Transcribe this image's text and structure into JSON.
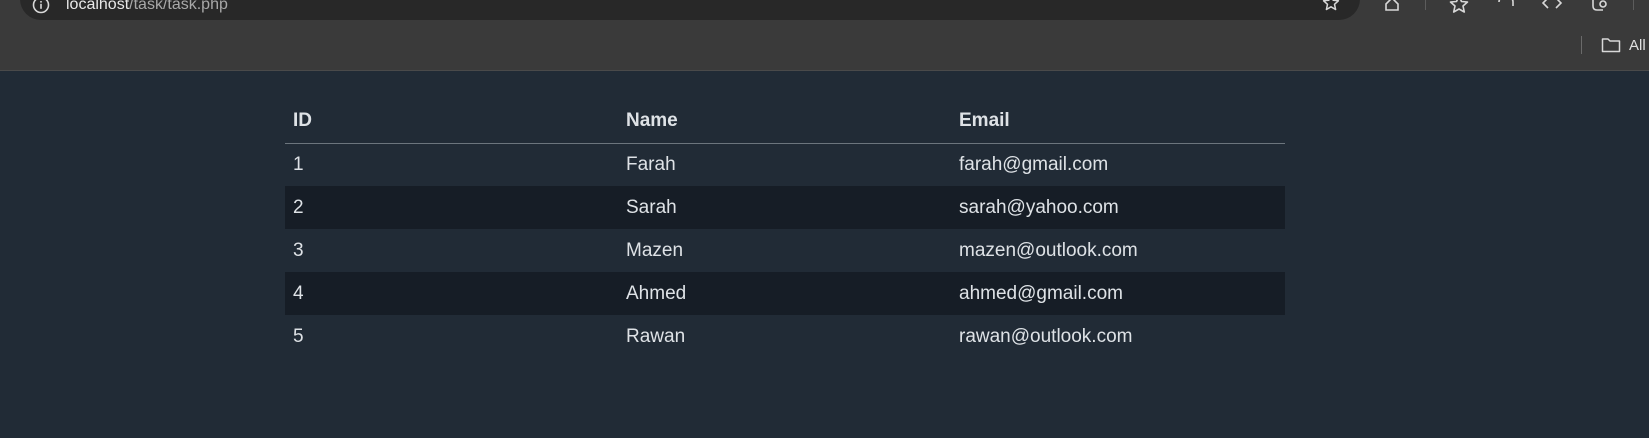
{
  "browser": {
    "url_host": "localhost",
    "url_path": "/task/task.php",
    "bookmarks_all_label": "All"
  },
  "table": {
    "headers": [
      "ID",
      "Name",
      "Email"
    ],
    "rows": [
      [
        "1",
        "Farah",
        "farah@gmail.com"
      ],
      [
        "2",
        "Sarah",
        "sarah@yahoo.com"
      ],
      [
        "3",
        "Mazen",
        "mazen@outlook.com"
      ],
      [
        "4",
        "Ahmed",
        "ahmed@gmail.com"
      ],
      [
        "5",
        "Rawan",
        "rawan@outlook.com"
      ]
    ]
  },
  "colors": {
    "page_bg": "#212b36",
    "striped_row_bg": "#161d26",
    "text": "#dee2e6"
  }
}
